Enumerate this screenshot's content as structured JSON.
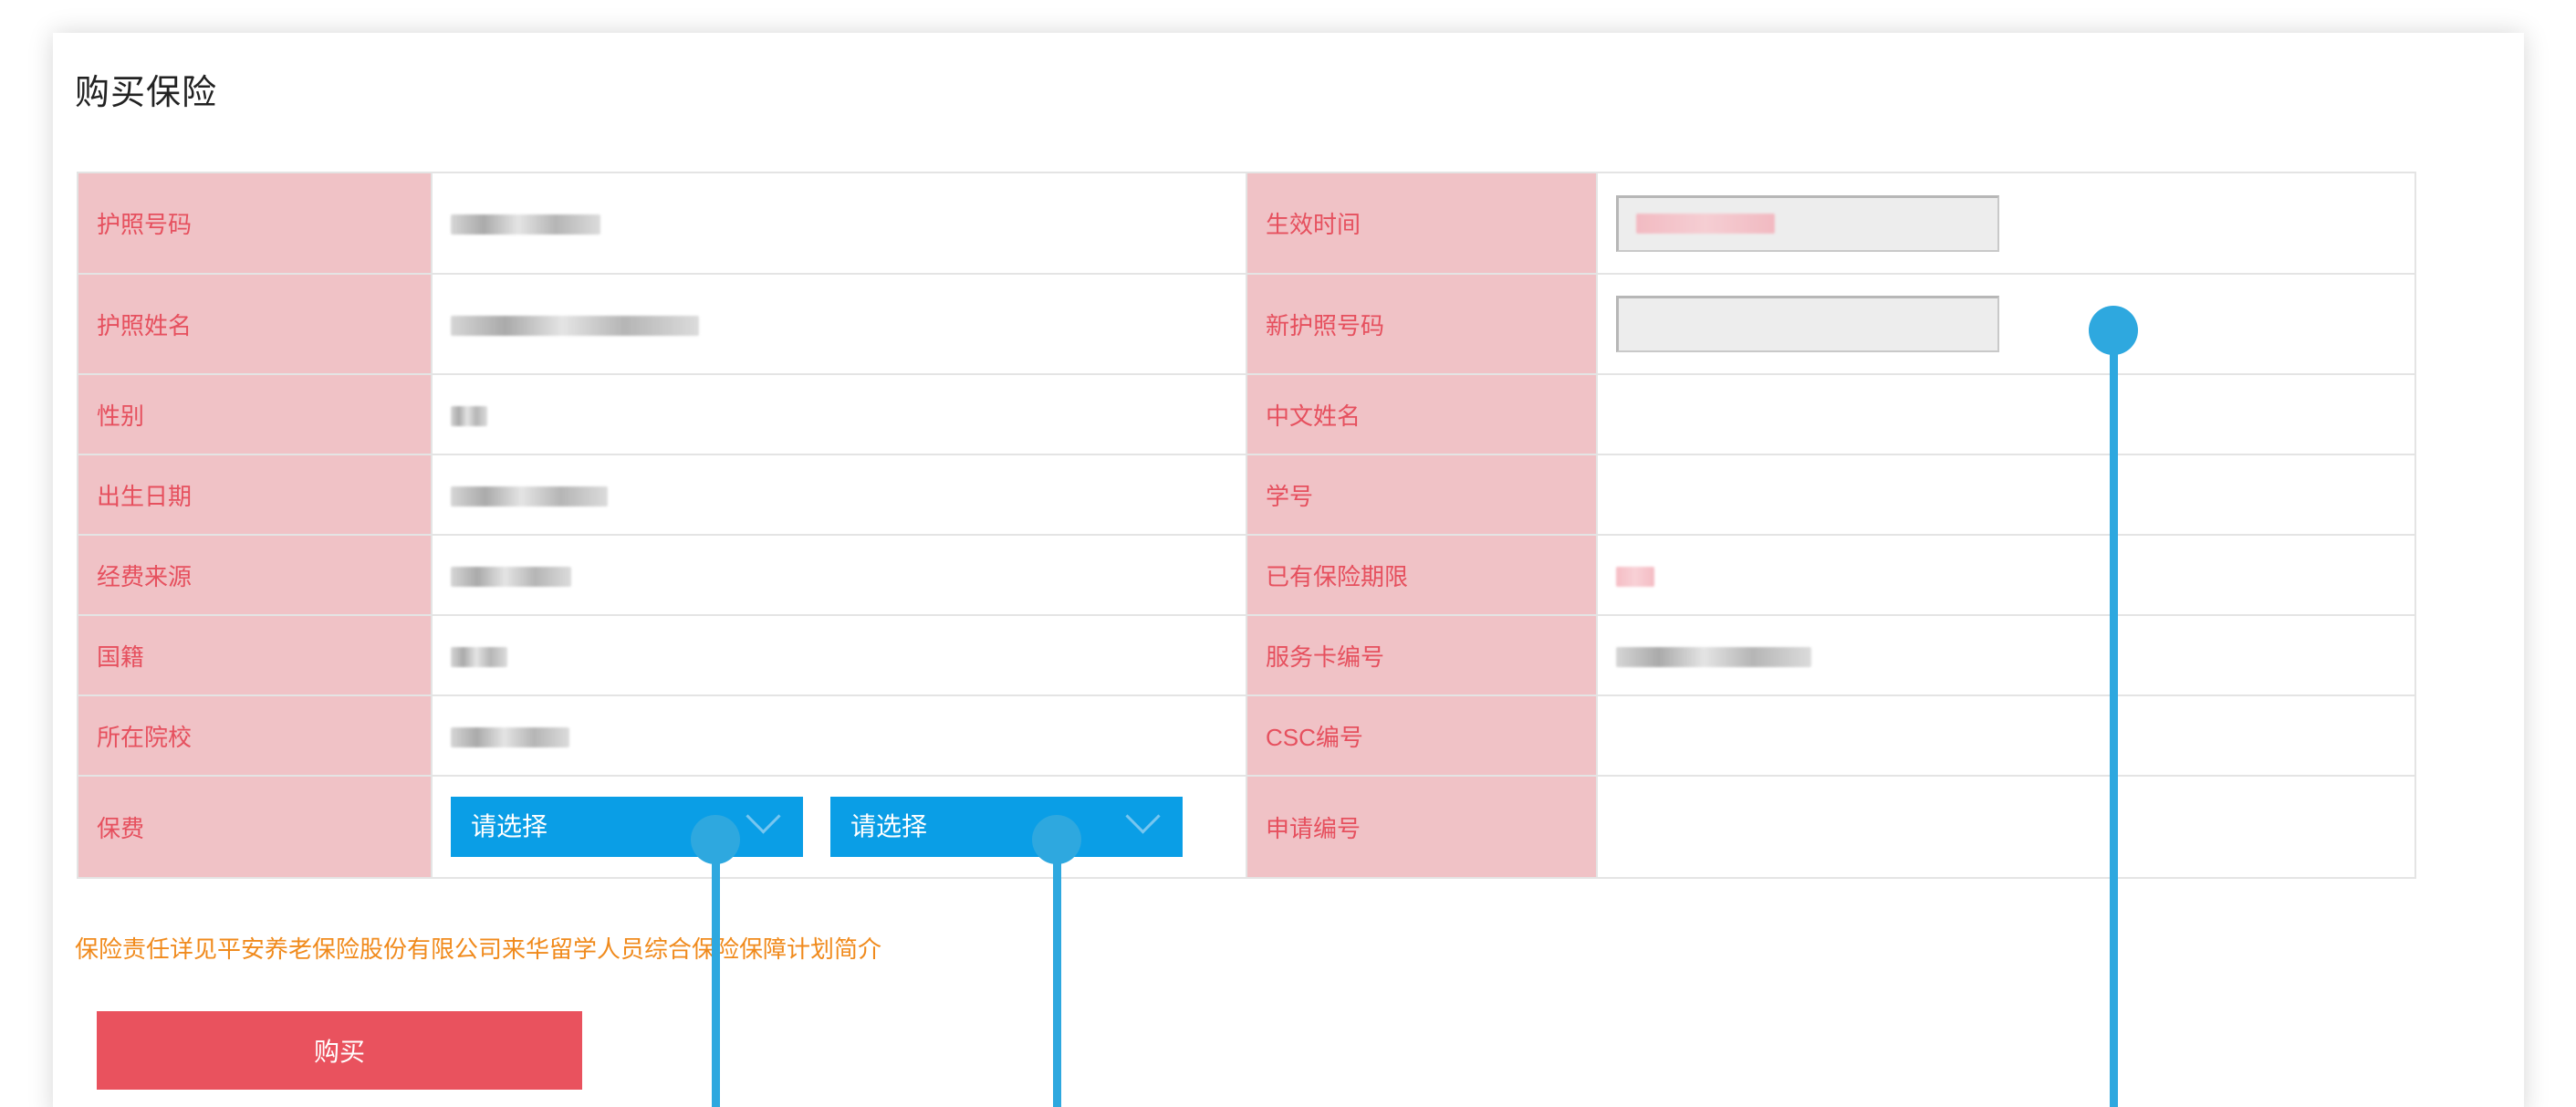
{
  "page_title": "购买保险",
  "rows": [
    {
      "left_label": "护照号码",
      "right_label": "生效时间"
    },
    {
      "left_label": "护照姓名",
      "right_label": "新护照号码"
    },
    {
      "left_label": "性别",
      "right_label": "中文姓名"
    },
    {
      "left_label": "出生日期",
      "right_label": "学号"
    },
    {
      "left_label": "经费来源",
      "right_label": "已有保险期限"
    },
    {
      "left_label": "国籍",
      "right_label": "服务卡编号"
    },
    {
      "left_label": "所在院校",
      "right_label": "CSC编号"
    },
    {
      "left_label": "保费",
      "right_label": "申请编号"
    }
  ],
  "premium_selects": [
    {
      "selected": "请选择"
    },
    {
      "selected": "请选择"
    }
  ],
  "new_passport_input": {
    "value": ""
  },
  "note_link": "保险责任详见平安养老保险股份有限公司来华留学人员综合保险保障计划简介",
  "buy_button": "购买",
  "colors": {
    "label_bg": "#f0c2c6",
    "label_text": "#e6505e",
    "select_bg": "#0a9ee6",
    "buy_bg": "#e9525e",
    "note_text": "#f08a1c",
    "callout": "#2ea8df"
  }
}
